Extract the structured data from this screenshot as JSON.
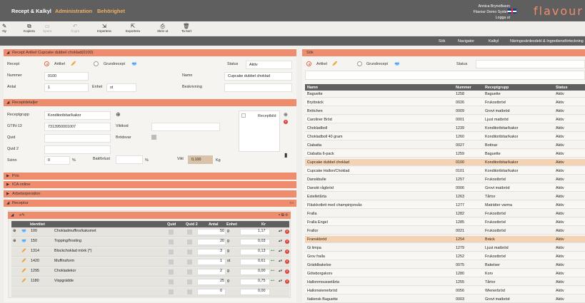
{
  "nav": {
    "brand": "Recept & Kalkyl",
    "admin": "Administration",
    "perm": "Behörighet"
  },
  "user": {
    "name": "Annica Brynolfsson",
    "company": "Flavour Demo System",
    "logout": "Logga ut"
  },
  "logo": "flavour",
  "toolbar": [
    {
      "icon": "✎",
      "label": "Ny",
      "disabled": false
    },
    {
      "icon": "⧉",
      "label": "Kopiera",
      "disabled": false
    },
    {
      "icon": "▭",
      "label": "Spara",
      "disabled": true
    },
    {
      "icon": "↶",
      "label": "Ångra",
      "disabled": true
    },
    {
      "icon": "⇲",
      "label": "Importera",
      "disabled": false
    },
    {
      "icon": "⇱",
      "label": "Exportera",
      "disabled": false
    },
    {
      "icon": "⎙",
      "label": "Skriv ut",
      "disabled": false
    },
    {
      "icon": "🗑",
      "label": "Ta bort",
      "disabled": false
    }
  ],
  "subnav": [
    "Sök",
    "Navigator",
    "Kalkyl",
    "Näringsvärdesdekl & Ingrediensförteckning"
  ],
  "recipe": {
    "header": "Recept  Artikel Cupcake dubbel choklad(0100)",
    "recept_label": "Recept",
    "artikel": "Artikel",
    "grundrecept": "Grundrecept",
    "status_label": "Status",
    "status": "Aktiv",
    "nummer_label": "Nummer",
    "nummer": "0100",
    "namn_label": "Namn",
    "namn": "Cupcake dubbel choklad",
    "antal_label": "Antal",
    "antal": "1",
    "enhet_label": "Enhet",
    "enhet": "st",
    "beskrivning_label": "Beskrivning"
  },
  "details": {
    "header": "Receptdetaljer",
    "grupp_label": "Receptgrupp",
    "grupp": "Konditoribitar/kakor",
    "gtin_label": "GTIN-13",
    "gtin": "7313950001007",
    "viktkod_label": "Viktkod",
    "quid_label": "Quid",
    "brodsvar_label": "Brödsvar",
    "quid2_label": "Quid 2",
    "svinn_label": "Svinn",
    "svinn": "0",
    "pct": "%",
    "bakforlust_label": "Bakförlust",
    "vikt_label": "Vikt",
    "vikt": "0,100",
    "kg": "Kg",
    "bild_label": "Receptbild"
  },
  "sections": [
    "Pris",
    "ICA online",
    "Arbetsoperation",
    "Receptur"
  ],
  "receptur": {
    "columns": [
      "Identitet",
      "Quid",
      "Quid 2",
      "Antal",
      "Enhet",
      "Kr"
    ],
    "rows": [
      {
        "id": "100",
        "name": "Chokladmuffins/kaksmet",
        "antal": "50",
        "enhet": "g",
        "kr": "1,17",
        "link": false,
        "expand": true
      },
      {
        "id": "150",
        "name": "Topping/frosting",
        "antal": "20",
        "enhet": "g",
        "kr": "0,03",
        "link": false,
        "expand": true
      },
      {
        "id": "1314",
        "name": "Blockchoklad mörk (*)",
        "antal": "3",
        "enhet": "g",
        "kr": "0,13",
        "link": true,
        "expand": false
      },
      {
        "id": "1420",
        "name": "Muffinsform",
        "antal": "1",
        "enhet": "st",
        "kr": "0,61",
        "link": true,
        "expand": false
      },
      {
        "id": "1295",
        "name": "Chokladekor",
        "antal": "2",
        "enhet": "g",
        "kr": "0,00",
        "link": true,
        "expand": false
      },
      {
        "id": "1180",
        "name": "Vispgrädde",
        "antal": "25",
        "enhet": "g",
        "kr": "0,75",
        "link": true,
        "expand": false
      },
      {
        "id": "",
        "name": "",
        "antal": "0",
        "enhet": "",
        "kr": "0,00",
        "link": false,
        "expand": false
      }
    ]
  },
  "search": {
    "header": "Sök",
    "artikel": "Artikel",
    "grundrecept": "Grundrecept",
    "status_label": "Status",
    "columns": [
      "Namn",
      "Nummer",
      "Receptgrupp",
      "Status"
    ],
    "rows": [
      [
        "Baguette",
        "1258",
        "Baguette",
        "Aktiv"
      ],
      [
        "Brytbräck",
        "0026",
        "Frukostbröd",
        "Aktiv"
      ],
      [
        "Brötchen",
        "0009",
        "Grovt matbröd",
        "Aktiv"
      ],
      [
        "Caroliner Bröd",
        "0001",
        "Ljust matbröd",
        "Aktiv"
      ],
      [
        "Chokladboll",
        "1239",
        "Konditoribitar/kakor",
        "Aktiv"
      ],
      [
        "Chokladboll 40 gram",
        "1260",
        "Konditoribitar/kakor",
        "Aktiv"
      ],
      [
        "Ciabatta",
        "0027",
        "Bottnar",
        "Aktiv"
      ],
      [
        "Ciabatta 6-pack",
        "1259",
        "Baguette",
        "Aktiv"
      ],
      [
        "Cupcake dubbel choklad",
        "0100",
        "Konditoribitar/kakor",
        "Aktiv"
      ],
      [
        "Cupcake Hallon/Choklad",
        "0101",
        "Konditoribitar/kakor",
        "Aktiv"
      ],
      [
        "Danskbulle",
        "1257",
        "Frukostbröd",
        "Aktiv"
      ],
      [
        "Danskt rågbröd",
        "0006",
        "Grovt matbröd",
        "Aktiv"
      ],
      [
        "Estelletårta",
        "1263",
        "Tårtor",
        "Aktiv"
      ],
      [
        "Fläskkotlett med champinjonsås",
        "1277",
        "Maträtter varma",
        "Aktiv"
      ],
      [
        "Fralla",
        "1282",
        "Frukostbröd",
        "Aktiv"
      ],
      [
        "Fralla Engel",
        "1285",
        "Frukostbröd",
        "Aktiv"
      ],
      [
        "Frallor",
        "0021",
        "Frukostbröd",
        "Aktiv"
      ],
      [
        "Franskbröd",
        "1254",
        "Bräck",
        "Aktiv"
      ],
      [
        "Gi limpa",
        "1279",
        "Ljust matbröd",
        "Aktiv"
      ],
      [
        "Grov fralla",
        "1252",
        "Frukostbröd",
        "Aktiv"
      ],
      [
        "Gräddbakelse",
        "0075",
        "Bakelser",
        "Aktiv"
      ],
      [
        "Göteborgskorv",
        "1280",
        "Korv",
        "Aktiv"
      ],
      [
        "Hallonmoussetårta",
        "1255",
        "Tårtor",
        "Aktiv"
      ],
      [
        "Hallonwienerbröd",
        "0056",
        "Wienerbröd",
        "Aktiv"
      ],
      [
        "Italiensk Baguette",
        "0003",
        "Grovt matbröd",
        "Aktiv"
      ]
    ],
    "selected": [
      8,
      17
    ]
  }
}
